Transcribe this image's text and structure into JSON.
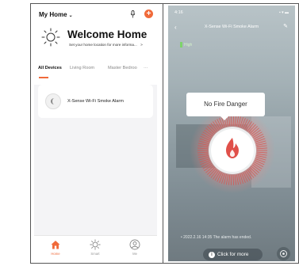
{
  "left_app": {
    "home_selector": "My Home",
    "welcome": "Welcome Home",
    "location_hint": "Set your home location for more informa...",
    "location_chevron": ">",
    "tabs": [
      "All Devices",
      "Living Room",
      "Master Bedroo"
    ],
    "more_tabs": "···",
    "devices": [
      {
        "name": "X-Sense Wi-Fi Smoke Alarm"
      }
    ],
    "nav": [
      {
        "label": "Home",
        "icon": "home-icon",
        "active": true
      },
      {
        "label": "Smart",
        "icon": "smart-icon",
        "active": false
      },
      {
        "label": "Me",
        "icon": "me-icon",
        "active": false
      }
    ],
    "accent_color": "#f06a3a"
  },
  "right_app": {
    "status_time": "4:16",
    "status_right": "▪ ▾ ▬",
    "title": "X-Sense Wi-Fi Smoke Alarm",
    "battery_label": "High",
    "status_bubble": "No Fire Danger",
    "alert_text": "2022.2.16 14:35  The alarm has ended.",
    "click_button": "Click for more",
    "flame_color": "#e0504a",
    "ring_color": "#d9534f"
  }
}
